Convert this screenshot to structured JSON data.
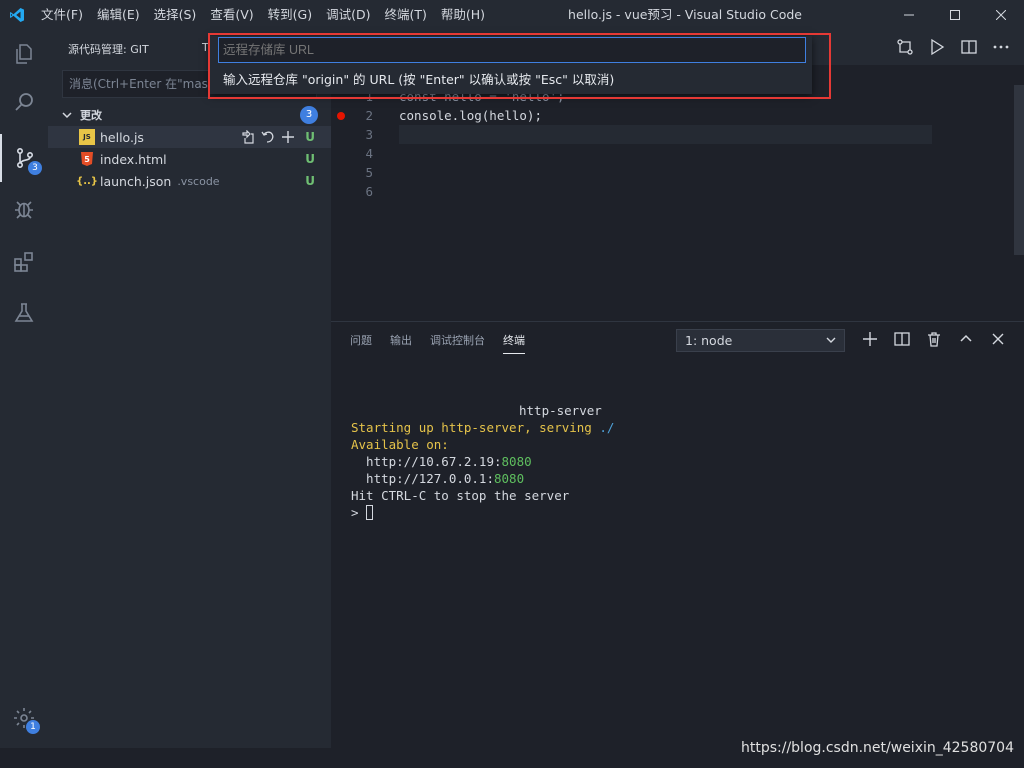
{
  "menu": [
    "文件(F)",
    "编辑(E)",
    "选择(S)",
    "查看(V)",
    "转到(G)",
    "调试(D)",
    "终端(T)",
    "帮助(H)"
  ],
  "window_title": "hello.js - vue预习 - Visual Studio Code",
  "activity": {
    "scm_badge": "3",
    "settings_badge": "1"
  },
  "sidebar": {
    "title": "源代码管理: GIT",
    "title2": "T",
    "commit_placeholder": "消息(Ctrl+Enter 在\"mast",
    "section_label": "更改",
    "section_count": "3",
    "files": [
      {
        "icon": "JS",
        "name": "hello.js",
        "dir": "",
        "status": "U"
      },
      {
        "icon": "5",
        "name": "index.html",
        "dir": "",
        "status": "U"
      },
      {
        "icon": "{..}",
        "name": "launch.json",
        "dir": ".vscode",
        "status": "U"
      }
    ]
  },
  "editor": {
    "lines": [
      {
        "n": "1",
        "code": "const hello = 'hello';"
      },
      {
        "n": "2",
        "code": "console.log(hello);"
      },
      {
        "n": "3",
        "code": ""
      },
      {
        "n": "4",
        "code": ""
      },
      {
        "n": "5",
        "code": ""
      },
      {
        "n": "6",
        "code": ""
      }
    ]
  },
  "panel": {
    "tabs": [
      "问题",
      "输出",
      "调试控制台",
      "终端"
    ],
    "terminal_select": "1: node",
    "terminal": {
      "banner": "http-server",
      "starting_prefix": "Starting up http-server, serving ",
      "starting_path": "./",
      "available": "Available on:",
      "url1_host": "  http://10.67.2.19:",
      "url1_port": "8080",
      "url2_host": "  http://127.0.0.1:",
      "url2_port": "8080",
      "stop": "Hit CTRL-C to stop the server",
      "prompt": "> "
    }
  },
  "quick_input": {
    "placeholder": "远程存储库 URL",
    "message": "输入远程仓库 \"origin\" 的 URL (按 \"Enter\" 以确认或按 \"Esc\" 以取消)"
  },
  "watermark": "https://blog.csdn.net/weixin_42580704"
}
